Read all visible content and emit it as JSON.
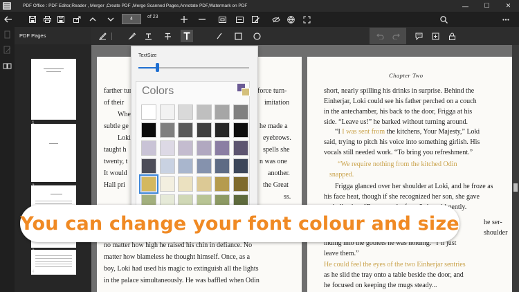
{
  "window": {
    "title": "PDF Office : PDF Editor,Reader , Merger ,Create PDF ,Merge Scanned Pages,Annotate PDF,Watermark on PDF",
    "controls": [
      "minimize",
      "maximize",
      "close"
    ]
  },
  "toolbar": {
    "current_page": "4",
    "page_total": "of 23",
    "icons": [
      "back-arrow-icon",
      "save-icon",
      "print-icon",
      "save-as-icon",
      "share-icon",
      "chevron-up-icon",
      "chevron-down-icon",
      "zoom-in-icon",
      "zoom-out-icon",
      "fit-page-icon",
      "fit-width-icon",
      "edit-icon",
      "hide-icon",
      "globe-icon",
      "fit-icon",
      "search-icon",
      "more-icon"
    ]
  },
  "sidebar": {
    "title": "PDF Pages",
    "pages": [
      {
        "number": "1"
      },
      {
        "number": "2"
      },
      {
        "number": "3"
      },
      {
        "number": "4"
      }
    ]
  },
  "annotation_toolbar": {
    "tools": [
      "pen",
      "highlighter",
      "underline",
      "strikethrough",
      "text",
      "line",
      "rectangle",
      "circle",
      "undo",
      "redo",
      "comment",
      "stamp",
      "lock"
    ],
    "active_tool": "text"
  },
  "popup": {
    "text_size_label": "TextSize",
    "text_size_value": 0.17,
    "colors_title": "Colors",
    "preview_colors": [
      "#6b5b95",
      "#d4c07c"
    ],
    "swatches": [
      [
        "#ffffff",
        "#f2f2f2",
        "#d9d9d9",
        "#bfbfbf",
        "#a6a6a6",
        "#808080"
      ],
      [
        "#0a0a0a",
        "#7f7f7f",
        "#595959",
        "#3f3f3f",
        "#262626",
        "#0d0d0d"
      ],
      [
        "#c9c3d6",
        "#ddd9e5",
        "#c4bccf",
        "#b1a8c0",
        "#8b7ea3",
        "#5d5570"
      ],
      [
        "#4d4d58",
        "#c9d2e2",
        "#a9b6cd",
        "#8592ad",
        "#5e6b84",
        "#3d475a"
      ],
      [
        "#d4b85f",
        "#f3efe0",
        "#ebe1c0",
        "#dcc995",
        "#b59b4e",
        "#7f6b2e"
      ],
      [
        "#a3b07e",
        "#e6ead8",
        "#d0d8b6",
        "#b8c494",
        "#8d9a64",
        "#5f6b3d"
      ]
    ],
    "selected_swatch": "#d4b85f"
  },
  "document": {
    "left_page_lines": [
      "farther turning forw",
      "of their",
      "When",
      "subtle ge",
      "Loki",
      "taught h",
      "twenty, t",
      "It would",
      "Hall pri",
      "",
      "",
      "no matter how high he raised his chin in defiance. No",
      "matter how blameless he thought himself. Once, as a",
      "boy, Loki had used his magic to extinguish all the lights",
      "in the palace simultaneously. He was baffled when Odin"
    ],
    "left_page_right_fragments": [
      "force turn-",
      "imitation",
      "",
      "he made a",
      "eyebrows.",
      "spells she",
      "n was one",
      "another.",
      "the Great",
      "ss."
    ],
    "chapter_title": "Chapter Two",
    "right_page_lines": [
      "short, nearly spilling his drinks in surprise. Behind the",
      "Einherjar, Loki could see his father perched on a couch",
      "in the antechamber, his back to the door, Frigga at his",
      "side. “Leave us!” he barked without turning around.",
      "“I was sent from the kitchens, Your Majesty,” Loki",
      "said, trying to pitch his voice into something girlish. His",
      "vocals still needed work. “To bring you refreshment.”",
      "“We require nothing from the kitched Odin",
      "snapped.",
      "Frigga glanced over her shoulder at Loki, and he froze as",
      "his face heat, though if she recognized her son, she gave",
      "no indication. “Return to the feast,” she said gently.",
      "",
      "he ser-",
      "shoulder",
      "inding into the goblets he was holding. “I’ll just",
      "leave them.”",
      "He could feel the eyes of the two Einherjar sentries",
      "as he slid the tray onto a table beside the door, and",
      "he focused on keeping the mugs steady..."
    ],
    "gold_text": "I was sent from"
  },
  "banner": {
    "text": "You can change your font colour and size"
  }
}
